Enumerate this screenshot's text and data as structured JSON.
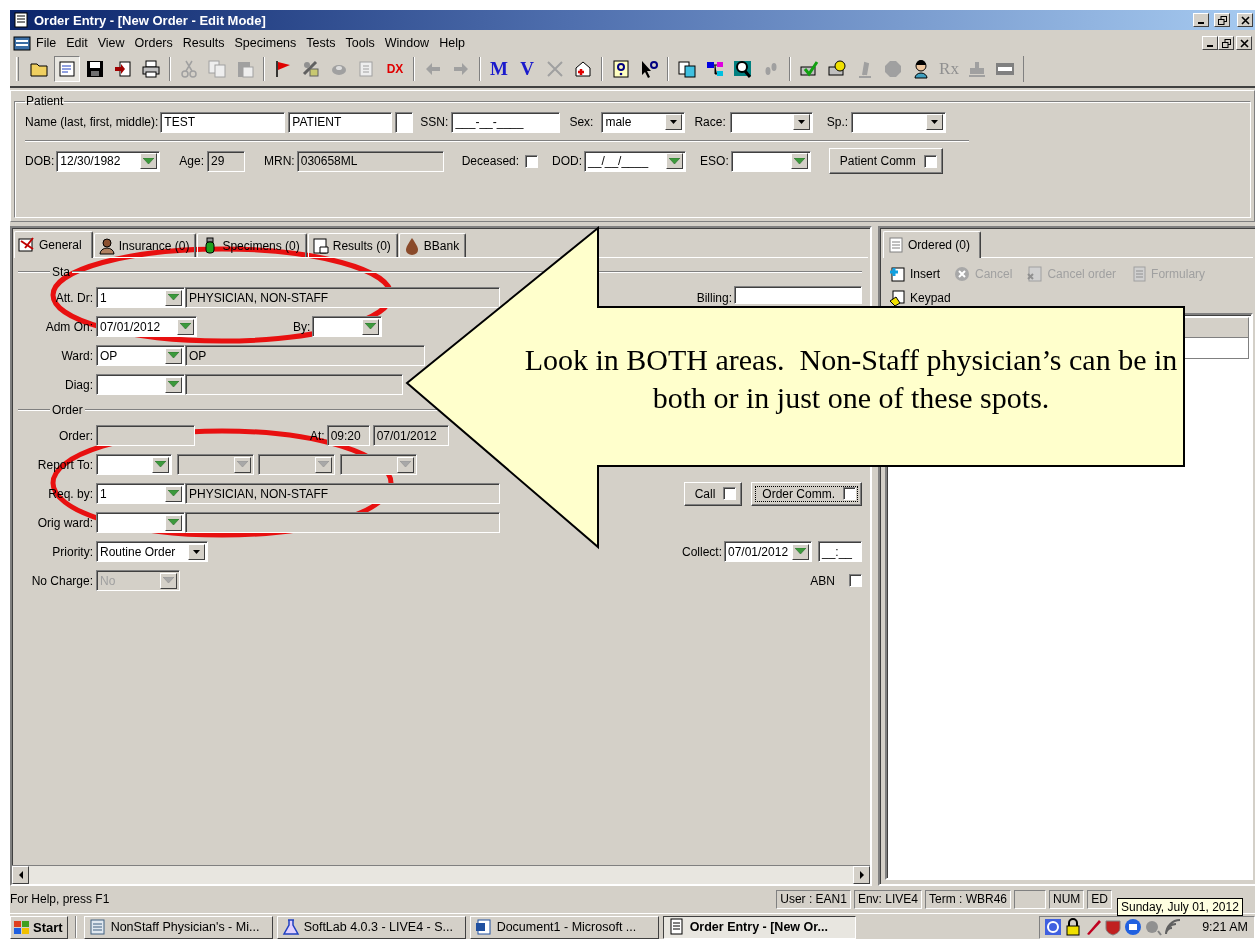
{
  "window": {
    "title": "Order Entry - [New Order  - Edit Mode]"
  },
  "menu": [
    "File",
    "Edit",
    "View",
    "Orders",
    "Results",
    "Specimens",
    "Tests",
    "Tools",
    "Window",
    "Help"
  ],
  "toolbar": {
    "letter_buttons": [
      "M",
      "V"
    ],
    "dx_label": "DX",
    "rx_label": "Rx"
  },
  "patient": {
    "title": "Patient",
    "name_label": "Name (last, first, middle):",
    "last": "TEST",
    "first": "PATIENT",
    "ssn_label": "SSN:",
    "ssn": "___-__-____",
    "sex_label": "Sex:",
    "sex": "male",
    "race_label": "Race:",
    "sp_label": "Sp.:",
    "dob_label": "DOB:",
    "dob": "12/30/1982",
    "age_label": "Age:",
    "age": "29",
    "mrn_label": "MRN:",
    "mrn": "030658ML",
    "deceased_label": "Deceased:",
    "deceased": false,
    "dod_label": "DOD:",
    "dod": "__/__/____",
    "eso_label": "ESO:",
    "comm_button": {
      "label": "Patient Comm",
      "checked": false
    }
  },
  "tabs": [
    {
      "label": "General",
      "selected": true
    },
    {
      "label": "Insurance (0)",
      "selected": false
    },
    {
      "label": "Specimens (0)",
      "selected": false
    },
    {
      "label": "Results (0)",
      "selected": false
    },
    {
      "label": "BBank",
      "selected": false
    }
  ],
  "form": {
    "section_1": "Sta",
    "att_dr": {
      "label": "Att. Dr:",
      "code": "1",
      "name": "PHYSICIAN, NON-STAFF"
    },
    "billing_label": "Billing:",
    "adm_on": {
      "label": "Adm On:",
      "value": "07/01/2012"
    },
    "by_label": "By:",
    "ward": {
      "label": "Ward:",
      "code": "OP",
      "name": "OP"
    },
    "diag_label": "Diag:",
    "section_2": "Order",
    "order_label": "Order:",
    "at_label": "At:",
    "at_time": "09:20",
    "at_date": "07/01/2012",
    "report_to_label": "Report To:",
    "req_by": {
      "label": "Req. by:",
      "code": "1",
      "name": "PHYSICIAN, NON-STAFF"
    },
    "orig_ward_label": "Orig ward:",
    "priority": {
      "label": "Priority:",
      "value": "Routine Order"
    },
    "no_charge": {
      "label": "No Charge:",
      "value": "No",
      "disabled": true
    },
    "call": {
      "label": "Call",
      "checked": false
    },
    "order_comm": {
      "label": "Order Comm.",
      "checked": false
    },
    "collect": {
      "label": "Collect:",
      "date": "07/01/2012",
      "time": "__:__"
    },
    "abn": {
      "label": "ABN",
      "checked": false
    }
  },
  "ordered_panel": {
    "tab": {
      "label": "Ordered (0)",
      "selected": true
    },
    "actions": [
      {
        "kind": "insert",
        "label": "Insert",
        "disabled": false
      },
      {
        "kind": "cancel",
        "label": "Cancel",
        "disabled": true
      },
      {
        "kind": "cancel-order",
        "label": "Cancel order",
        "disabled": true
      },
      {
        "kind": "formulary",
        "label": "Formulary",
        "disabled": true
      },
      {
        "kind": "keypad",
        "label": "Keypad",
        "disabled": false
      }
    ]
  },
  "status_bar": {
    "help": "For Help, press F1",
    "panels": [
      {
        "kind": "text",
        "text": "User : EAN1"
      },
      {
        "kind": "text",
        "text": "Env: LIVE4"
      },
      {
        "kind": "text",
        "text": "Term : WBR46"
      },
      {
        "kind": "blank"
      },
      {
        "kind": "text",
        "text": "NUM"
      },
      {
        "kind": "text",
        "text": "ED"
      }
    ]
  },
  "tooltip": "Sunday, July 01, 2012",
  "taskbar": {
    "start": "Start",
    "tasks": [
      {
        "label": "NonStaff Physician's - Mi...",
        "selected": false
      },
      {
        "label": "SoftLab 4.0.3 - LIVE4 - S...",
        "selected": false
      },
      {
        "label": "Document1 - Microsoft ...",
        "selected": false
      },
      {
        "label": "Order Entry - [New Or...",
        "selected": true
      }
    ],
    "clock": "9:21 AM"
  },
  "annotation": {
    "text": "Look in BOTH areas.  Non-Staff physician’s can be in both or in just one of these spots."
  }
}
